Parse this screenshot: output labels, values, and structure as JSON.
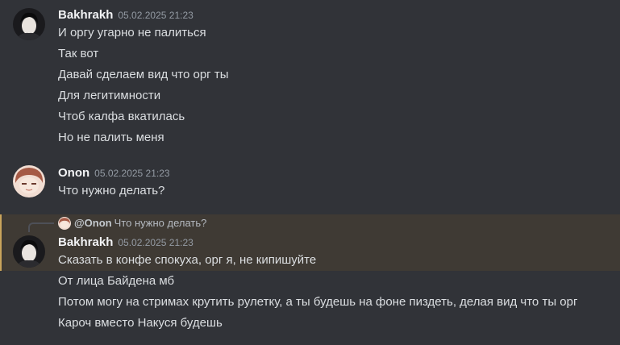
{
  "messages": [
    {
      "author": "Bakhrakh",
      "timestamp": "05.02.2025 21:23",
      "lines": [
        "И оргу угарно не палиться",
        "Так вот",
        "Давай сделаем вид что орг ты",
        "Для легитимности",
        "Чтоб калфа вкатилась",
        "Но не палить меня"
      ]
    },
    {
      "author": "Onon",
      "timestamp": "05.02.2025 21:23",
      "lines": [
        "Что нужно делать?"
      ]
    },
    {
      "reply_to": {
        "author": "@Onon",
        "text": "Что нужно делать?"
      },
      "author": "Bakhrakh",
      "timestamp": "05.02.2025 21:23",
      "lines": [
        "Сказать в конфе спокуха, орг я, не кипишуйте",
        "От лица Байдена мб",
        "Потом могу на стримах крутить рулетку, а ты будешь на фоне пиздеть, делая вид что ты орг",
        "Кароч вместо Накуся будешь"
      ]
    }
  ],
  "colors": {
    "background": "#313338",
    "highlight": "#3f3a34",
    "highlight_bar": "#c9a45c"
  }
}
